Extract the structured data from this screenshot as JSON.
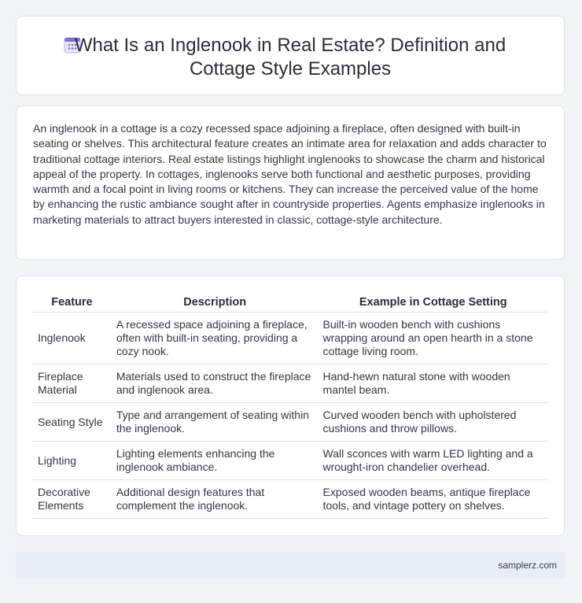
{
  "header": {
    "icon": "calendar-icon",
    "title_line1": "What Is an Inglenook in Real Estate? Definition and",
    "title_line2": "Cottage Style Examples"
  },
  "intro": {
    "text": "An inglenook in a cottage is a cozy recessed space adjoining a fireplace, often designed with built-in seating or shelves. This architectural feature creates an intimate area for relaxation and adds character to traditional cottage interiors. Real estate listings highlight inglenooks to showcase the charm and historical appeal of the property. In cottages, inglenooks serve both functional and aesthetic purposes, providing warmth and a focal point in living rooms or kitchens. They can increase the perceived value of the home by enhancing the rustic ambiance sought after in countryside properties. Agents emphasize inglenooks in marketing materials to attract buyers interested in classic, cottage-style architecture."
  },
  "table": {
    "headers": [
      "Feature",
      "Description",
      "Example in Cottage Setting"
    ],
    "rows": [
      [
        "Inglenook",
        "A recessed space adjoining a fireplace, often with built-in seating, providing a cozy nook.",
        "Built-in wooden bench with cushions wrapping around an open hearth in a stone cottage living room."
      ],
      [
        "Fireplace Material",
        "Materials used to construct the fireplace and inglenook area.",
        "Hand-hewn natural stone with wooden mantel beam."
      ],
      [
        "Seating Style",
        "Type and arrangement of seating within the inglenook.",
        "Curved wooden bench with upholstered cushions and throw pillows."
      ],
      [
        "Lighting",
        "Lighting elements enhancing the inglenook ambiance.",
        "Wall sconces with warm LED lighting and a wrought-iron chandelier overhead."
      ],
      [
        "Decorative Elements",
        "Additional design features that complement the inglenook.",
        "Exposed wooden beams, antique fireplace tools, and vintage pottery on shelves."
      ]
    ]
  },
  "footer": {
    "site": "samplerz.com"
  },
  "colors": {
    "background": "#f1f3f6",
    "card": "#ffffff",
    "footer": "#e9edf8",
    "icon_accent": "#7b6fd6"
  }
}
